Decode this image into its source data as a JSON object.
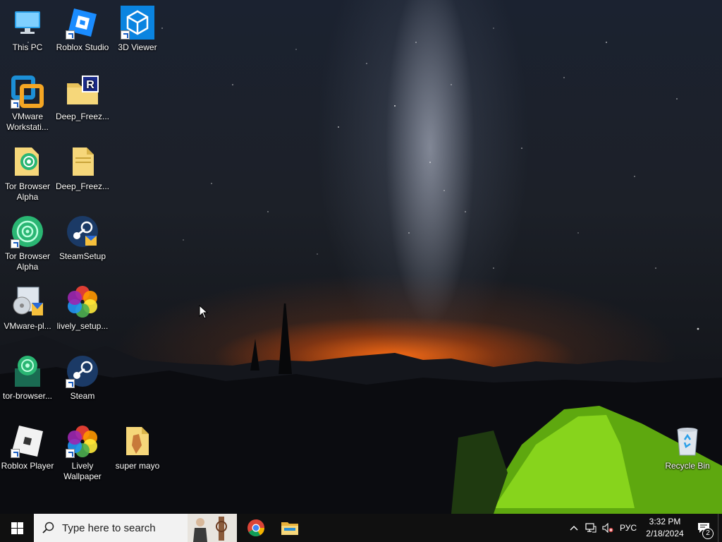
{
  "desktop": {
    "icons": [
      {
        "label": "This PC"
      },
      {
        "label": "Roblox Studio"
      },
      {
        "label": "3D Viewer"
      },
      {
        "label": "VMware Workstati..."
      },
      {
        "label": "Deep_Freez..."
      },
      {
        "label": "Tor Browser Alpha"
      },
      {
        "label": "Deep_Freez..."
      },
      {
        "label": "Tor Browser Alpha"
      },
      {
        "label": "SteamSetup"
      },
      {
        "label": "VMware-pl..."
      },
      {
        "label": "lively_setup..."
      },
      {
        "label": "tor-browser..."
      },
      {
        "label": "Steam"
      },
      {
        "label": "Roblox Player"
      },
      {
        "label": "Lively Wallpaper"
      },
      {
        "label": "super mayo"
      },
      {
        "label": "Recycle Bin"
      }
    ]
  },
  "taskbar": {
    "search_placeholder": "Type here to search",
    "language": "РУС",
    "time": "3:32 PM",
    "date": "2/18/2024",
    "notification_count": "2"
  },
  "colors": {
    "taskbar": "#101010",
    "search_bg": "#f2f2f2",
    "accent": "#0078d7",
    "tent_green": "#8edc1e"
  }
}
